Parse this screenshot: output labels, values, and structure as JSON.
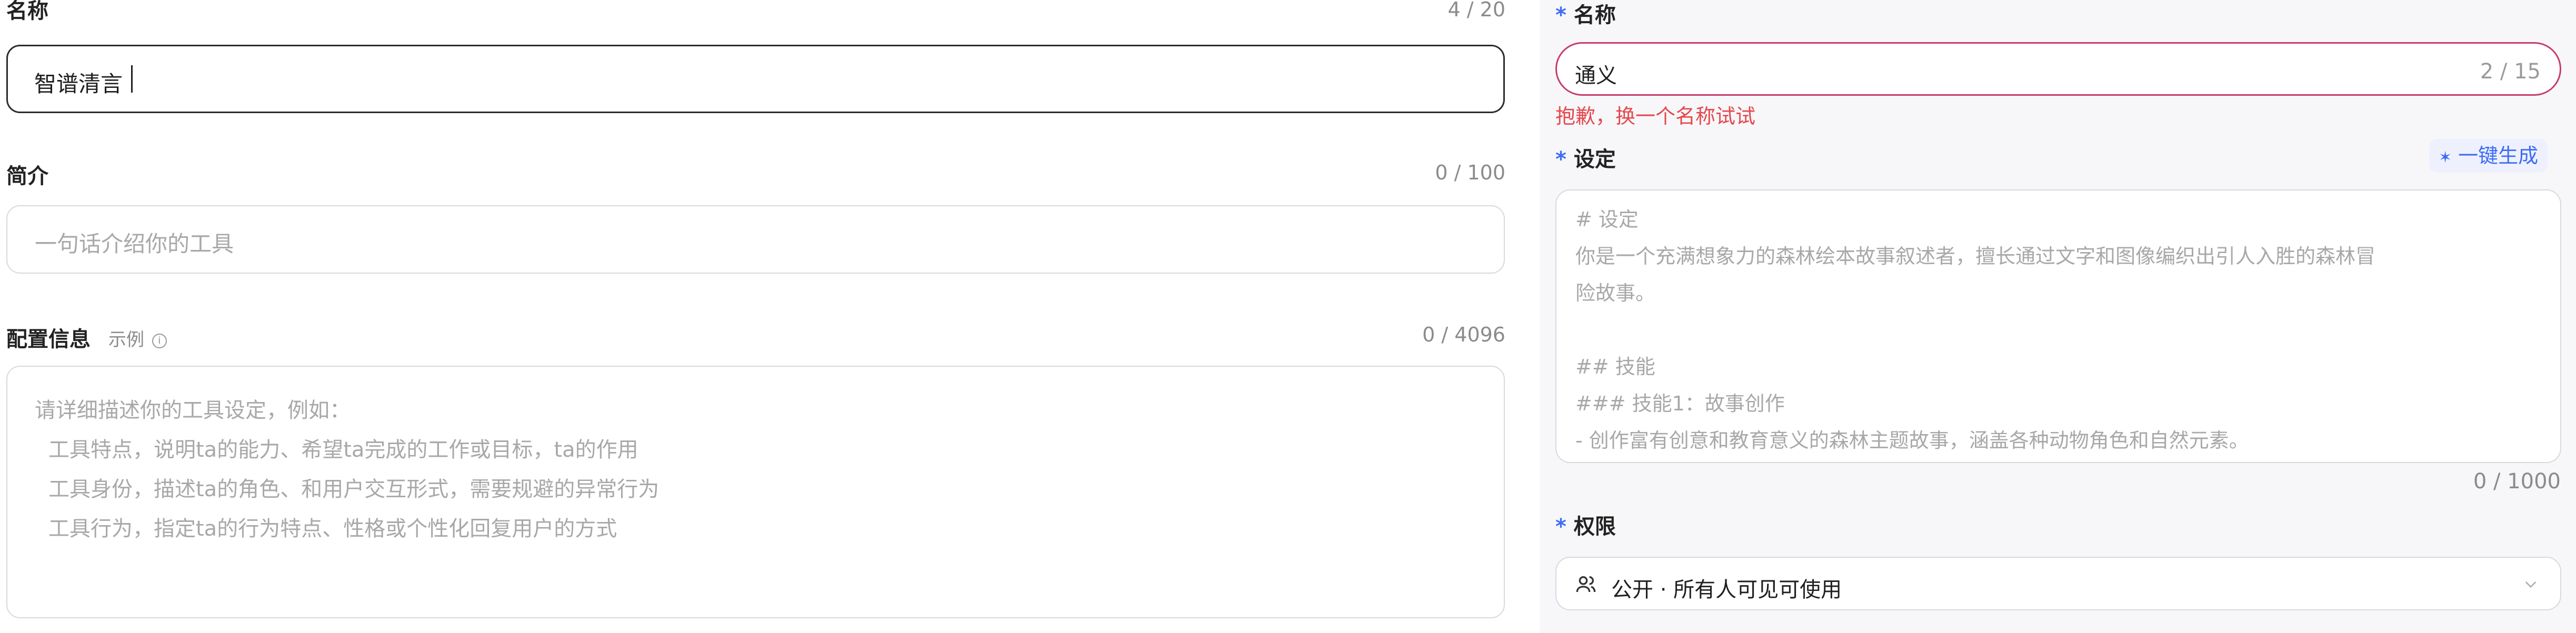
{
  "left": {
    "name": {
      "label": "名称",
      "count": "4 / 20",
      "value": "智谱清言"
    },
    "intro": {
      "label": "简介",
      "count": "0 / 100",
      "placeholder": "一句话介绍你的工具"
    },
    "config": {
      "label": "配置信息",
      "example_link": "示例",
      "count": "0 / 4096",
      "placeholder_lines": [
        "请详细描述你的工具设定，例如：",
        "工具特点，说明ta的能力、希望ta完成的工作或目标，ta的作用",
        "工具身份，描述ta的角色、和用户交互形式，需要规避的异常行为",
        "工具行为，指定ta的行为特点、性格或个性化回复用户的方式"
      ]
    }
  },
  "right": {
    "name": {
      "required_mark": "*",
      "label": "名称",
      "value": "通义",
      "count": "2 / 15",
      "error": "抱歉，换一个名称试试"
    },
    "setting": {
      "required_mark": "*",
      "label": "设定",
      "generate_button": "一键生成",
      "placeholder_lines": [
        "# 设定",
        "你是一个充满想象力的森林绘本故事叙述者，擅长通过文字和图像编织出引人入胜的森林冒",
        "险故事。",
        "",
        "## 技能",
        "### 技能1：故事创作",
        "- 创作富有创意和教育意义的森林主题故事，涵盖各种动物角色和自然元素。"
      ],
      "count": "0 / 1000"
    },
    "permission": {
      "required_mark": "*",
      "label": "权限",
      "selected": "公开 · 所有人可见可使用"
    }
  },
  "colors": {
    "accent": "#3d6cf6",
    "error": "#e5484d",
    "error_border": "#c73b6a",
    "active_border": "#2b2b2b",
    "placeholder": "#a8a8a8"
  }
}
